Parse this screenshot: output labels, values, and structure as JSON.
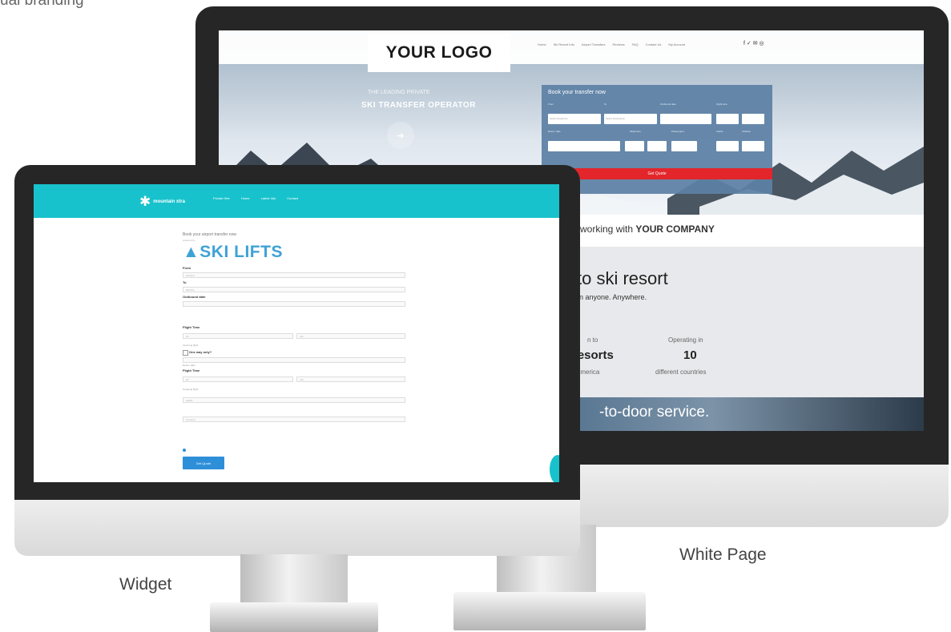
{
  "captions": {
    "widget": "Widget",
    "white_page": "White Page",
    "top_fragment": "ual branding"
  },
  "white_page": {
    "logo": "YOUR LOGO",
    "nav": [
      "Home",
      "Ski Resort Info",
      "Airport Transfers",
      "Reviews",
      "FAQ",
      "Contact Us",
      "My Account"
    ],
    "social": "f ✓ ✉ ◎",
    "hero_sub": "THE LEADING PRIVATE",
    "hero_title": "SKI TRANSFER OPERATOR",
    "hero_icon": "car-icon",
    "booking": {
      "title": "Book your transfer now",
      "labels": [
        "From",
        "To",
        "Outbound date",
        "Flight time",
        "Return date",
        "Flight time",
        "Passengers",
        "Adults",
        "Children"
      ],
      "selects": [
        "Select Departure",
        "Select Destination"
      ],
      "quote_button": "Get Quote"
    },
    "company_prefix": "e working with",
    "company_name": "YOUR COMPANY",
    "resort_title": "to ski resort",
    "resort_sub": "an anyone. Anywhere.",
    "stats": [
      {
        "label": "n to",
        "value": "resorts",
        "desc": "America"
      },
      {
        "label": "Operating in",
        "value": "10",
        "desc": "different countries"
      }
    ],
    "door_text": "-to-door service."
  },
  "widget": {
    "brand_small": "mountain xtra",
    "menu": [
      "Private Hire",
      "Home",
      "Latest Info",
      "Contact"
    ],
    "form_small": "Book your airport transfer now",
    "form_tiny": "powered by",
    "brand": "SKI LIFTS",
    "labels": {
      "from": "From",
      "to": "To",
      "outbound_date": "Outbound date",
      "flight_time": "Flight Time",
      "one_way": "One way only?",
      "flight_time_2": "Flight Time"
    },
    "notes": {
      "incoming": "Incoming flight",
      "return_date": "Return date",
      "outgoing": "Outgoing flight"
    },
    "fields": {
      "from": "Geneva",
      "to": "Morzine",
      "hh": "10",
      "mm": "min",
      "passengers": "Adults",
      "currency": "Currency"
    },
    "button": "Get Quote"
  },
  "colors": {
    "widget_accent": "#18c2cc",
    "widget_brand": "#3fa2d6",
    "quote_red": "#e2262b",
    "form_blue": "#5d80a5"
  }
}
